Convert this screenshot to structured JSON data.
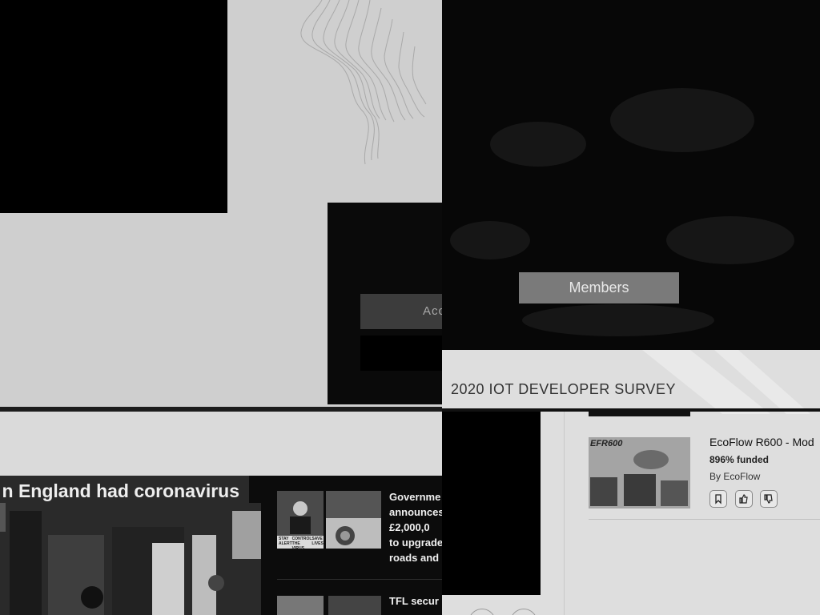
{
  "modal": {
    "primary_button_label": "Acc"
  },
  "hero": {
    "members_button_label": "Members"
  },
  "news": {
    "headline": "n England had coronavirus",
    "story1_lines": [
      "Governme",
      "announces",
      "£2,000,0",
      "to upgrade",
      "roads and"
    ],
    "story1_thumb_caption": [
      "STAY",
      "CONTROL",
      "SAVE",
      "ALERT",
      "THE VIRUS",
      "LIVES"
    ],
    "story2_text": "TFL secur"
  },
  "survey": {
    "title": "2020 IOT DEVELOPER SURVEY",
    "product": {
      "name": "EcoFlow R600 - Mod",
      "funded": "896% funded",
      "by": "By EcoFlow",
      "thumb_logo": "EFR600"
    },
    "actions": [
      {
        "icon": "bookmark-icon"
      },
      {
        "icon": "thumbs-up-icon"
      },
      {
        "icon": "thumbs-down-icon"
      }
    ]
  },
  "colors": {
    "dark": "#000000",
    "panel_gray": "#cfcfcf",
    "button_gray": "#7a7a7a",
    "text_light": "#eeeeee"
  }
}
